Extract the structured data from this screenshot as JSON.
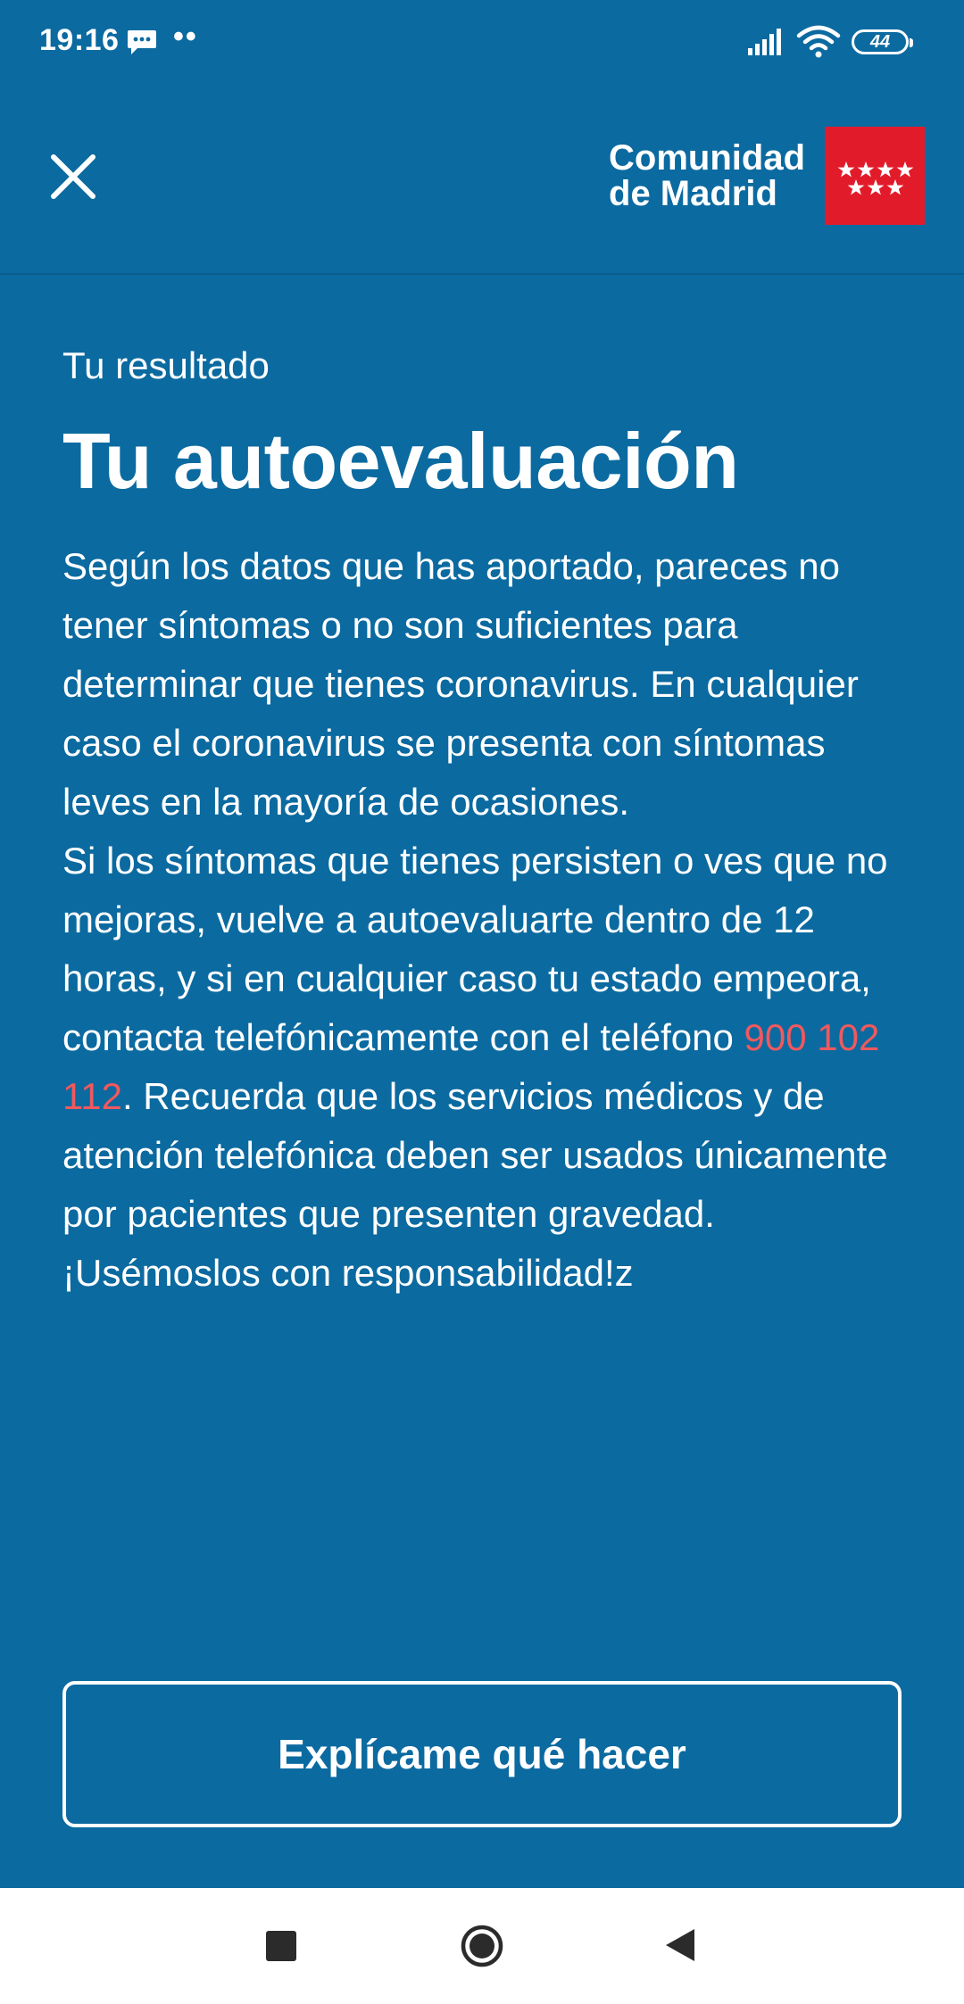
{
  "status_bar": {
    "time": "19:16",
    "dots": "••",
    "battery_level": "44"
  },
  "header": {
    "brand_line1": "Comunidad",
    "brand_line2": "de Madrid",
    "close_icon": "close-icon",
    "flag_icon": "madrid-flag-stars-icon"
  },
  "main": {
    "subtitle": "Tu resultado",
    "title": "Tu autoevaluación",
    "paragraph1": "Según los datos que has aportado, pareces no tener síntomas o no son suficientes para determinar que tienes coronavirus. En cualquier caso el coronavirus se presenta con síntomas leves en la mayoría de ocasiones.",
    "paragraph2_before": "Si los síntomas que tienes persisten o ves que no mejoras, vuelve a autoevaluarte dentro de 12 horas, y si en cualquier caso tu estado empeora, contacta telefónicamente con el teléfono ",
    "phone": "900 102 112",
    "paragraph2_after": ". Recuerda que los servicios médicos y de atención telefónica deben ser usados únicamente por pacientes que presenten gravedad. ¡Usémoslos con responsabilidad!z"
  },
  "actions": {
    "explain_label": "Explícame qué hacer"
  },
  "colors": {
    "background": "#0b6aa0",
    "brand_red": "#e21b2b",
    "phone_link": "#f0595e"
  }
}
